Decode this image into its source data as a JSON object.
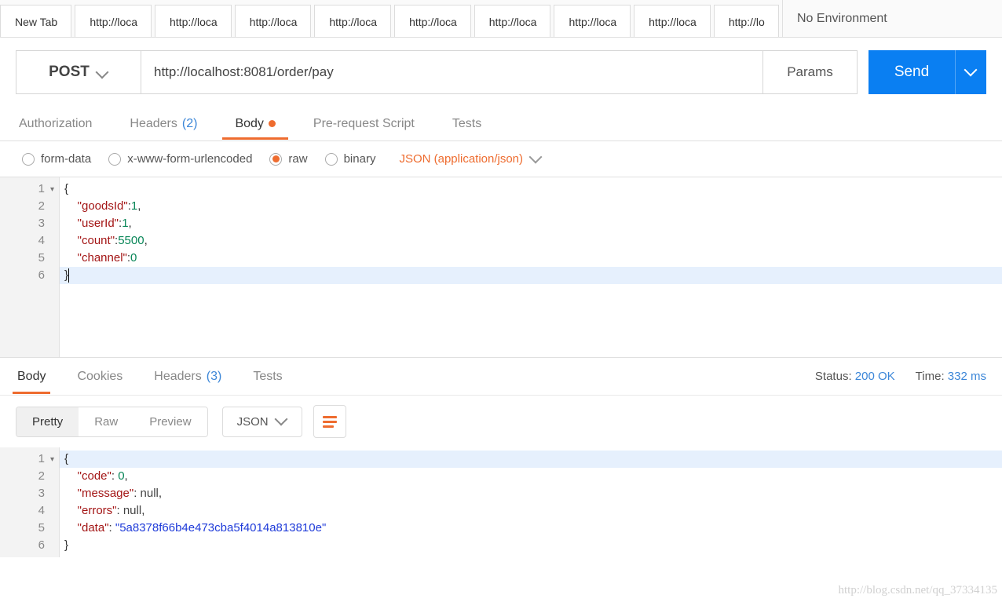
{
  "env": {
    "label": "No Environment"
  },
  "tabs": [
    {
      "label": "New Tab"
    },
    {
      "label": "http://loca"
    },
    {
      "label": "http://loca"
    },
    {
      "label": "http://loca"
    },
    {
      "label": "http://loca"
    },
    {
      "label": "http://loca"
    },
    {
      "label": "http://loca"
    },
    {
      "label": "http://loca"
    },
    {
      "label": "http://loca"
    },
    {
      "label": "http://lo"
    }
  ],
  "request": {
    "method": "POST",
    "url": "http://localhost:8081/order/pay",
    "params_label": "Params",
    "send_label": "Send"
  },
  "req_tabs": {
    "authorization": "Authorization",
    "headers": "Headers",
    "headers_count": "(2)",
    "body": "Body",
    "prerequest": "Pre-request Script",
    "tests": "Tests"
  },
  "body_types": {
    "form_data": "form-data",
    "urlencoded": "x-www-form-urlencoded",
    "raw": "raw",
    "binary": "binary",
    "content_type": "JSON (application/json)"
  },
  "request_body": {
    "lines": [
      "1",
      "2",
      "3",
      "4",
      "5",
      "6"
    ],
    "json": {
      "goodsId": 1,
      "userId": 1,
      "count": 5500,
      "channel": 0
    }
  },
  "resp_tabs": {
    "body": "Body",
    "cookies": "Cookies",
    "headers": "Headers",
    "headers_count": "(3)",
    "tests": "Tests"
  },
  "status": {
    "label": "Status:",
    "value": "200 OK"
  },
  "time": {
    "label": "Time:",
    "value": "332 ms"
  },
  "view_modes": {
    "pretty": "Pretty",
    "raw": "Raw",
    "preview": "Preview"
  },
  "format": "JSON",
  "response_body": {
    "lines": [
      "1",
      "2",
      "3",
      "4",
      "5",
      "6"
    ],
    "json": {
      "code": 0,
      "message": null,
      "errors": null,
      "data": "5a8378f66b4e473cba5f4014a813810e"
    }
  },
  "watermark": "http://blog.csdn.net/qq_37334135"
}
